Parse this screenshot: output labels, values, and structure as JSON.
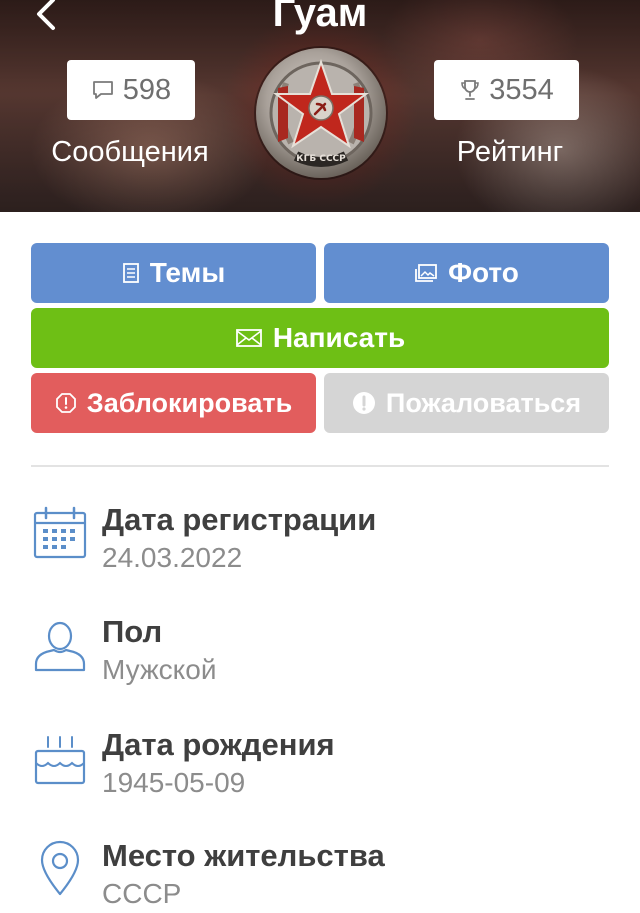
{
  "header": {
    "title": "Гуам",
    "back_icon": "chevron-left-icon",
    "messages": {
      "count": "598",
      "label": "Сообщения",
      "icon": "speech-bubble-icon"
    },
    "rating": {
      "count": "3554",
      "label": "Рейтинг",
      "icon": "trophy-icon"
    },
    "avatar": {
      "badge_text": "КГБ СССР"
    }
  },
  "actions": {
    "topics": {
      "label": "Темы",
      "icon": "document-icon",
      "color": "#628ed0"
    },
    "photo": {
      "label": "Фото",
      "icon": "image-icon",
      "color": "#628ed0"
    },
    "write": {
      "label": "Написать",
      "icon": "envelope-icon",
      "color": "#6ebf15"
    },
    "block": {
      "label": "Заблокировать",
      "icon": "block-icon",
      "color": "#e25d5d"
    },
    "report": {
      "label": "Пожаловаться",
      "icon": "exclamation-icon",
      "color": "#d5d5d5"
    }
  },
  "profile": [
    {
      "label": "Дата регистрации",
      "value": "24.03.2022",
      "icon": "calendar-icon"
    },
    {
      "label": "Пол",
      "value": "Мужской",
      "icon": "person-icon"
    },
    {
      "label": "Дата рождения",
      "value": "1945-05-09",
      "icon": "cake-icon"
    },
    {
      "label": "Место жительства",
      "value": "СССР",
      "icon": "location-pin-icon"
    }
  ],
  "colors": {
    "icon_blue": "#5b8ec9",
    "label": "#3f3f3f",
    "value": "#8c8c8c"
  }
}
